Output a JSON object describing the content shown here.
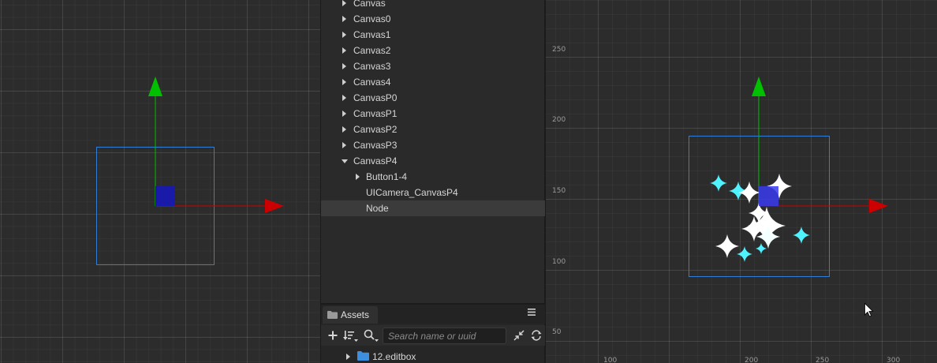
{
  "hierarchy": {
    "items": [
      {
        "label": "Canvas",
        "expanded": false,
        "depth": 0,
        "selected": false
      },
      {
        "label": "Canvas0",
        "expanded": false,
        "depth": 0,
        "selected": false
      },
      {
        "label": "Canvas1",
        "expanded": false,
        "depth": 0,
        "selected": false
      },
      {
        "label": "Canvas2",
        "expanded": false,
        "depth": 0,
        "selected": false
      },
      {
        "label": "Canvas3",
        "expanded": false,
        "depth": 0,
        "selected": false
      },
      {
        "label": "Canvas4",
        "expanded": false,
        "depth": 0,
        "selected": false
      },
      {
        "label": "CanvasP0",
        "expanded": false,
        "depth": 0,
        "selected": false
      },
      {
        "label": "CanvasP1",
        "expanded": false,
        "depth": 0,
        "selected": false
      },
      {
        "label": "CanvasP2",
        "expanded": false,
        "depth": 0,
        "selected": false
      },
      {
        "label": "CanvasP3",
        "expanded": false,
        "depth": 0,
        "selected": false
      },
      {
        "label": "CanvasP4",
        "expanded": true,
        "depth": 0,
        "selected": false
      },
      {
        "label": "Button1-4",
        "expanded": false,
        "depth": 1,
        "selected": false
      },
      {
        "label": "UICamera_CanvasP4",
        "expanded": null,
        "depth": 1,
        "selected": false
      },
      {
        "label": "Node",
        "expanded": null,
        "depth": 1,
        "selected": true
      }
    ]
  },
  "assets": {
    "tab_label": "Assets",
    "search_placeholder": "Search name or uuid",
    "items": [
      {
        "label": "12.editbox",
        "expanded": false,
        "icon": "folder-icon"
      }
    ]
  },
  "scene_right": {
    "y_axis_labels": [
      "250",
      "200",
      "150",
      "100",
      "50"
    ],
    "x_axis_labels": [
      "100",
      "200",
      "250",
      "300"
    ]
  },
  "colors": {
    "axis_x": "#cc0000",
    "axis_y": "#00c000",
    "selection_rect": "#2f7fd8",
    "node_gizmo": "#1a1aa8",
    "particle_cyan": "#4ff2ff",
    "folder": "#3d8fe0"
  }
}
